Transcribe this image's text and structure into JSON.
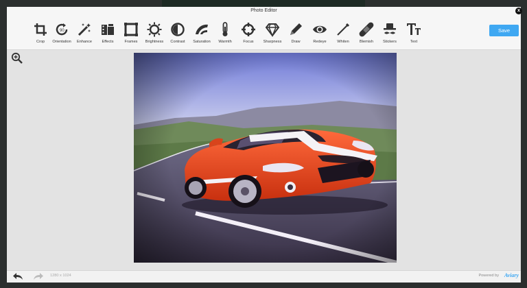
{
  "window": {
    "title": "Photo Editor",
    "close_label": "x"
  },
  "toolbar": {
    "tools": [
      {
        "label": "Crop",
        "icon": "crop-icon"
      },
      {
        "label": "Orientation",
        "icon": "orientation-icon"
      },
      {
        "label": "Enhance",
        "icon": "magic-wand-icon"
      },
      {
        "label": "Effects",
        "icon": "film-strip-icon"
      },
      {
        "label": "Frames",
        "icon": "frame-icon"
      },
      {
        "label": "Brightness",
        "icon": "sun-icon"
      },
      {
        "label": "Contrast",
        "icon": "contrast-icon"
      },
      {
        "label": "Saturation",
        "icon": "saturation-icon"
      },
      {
        "label": "Warmth",
        "icon": "thermometer-icon"
      },
      {
        "label": "Focus",
        "icon": "crosshair-icon"
      },
      {
        "label": "Sharpness",
        "icon": "diamond-icon"
      },
      {
        "label": "Draw",
        "icon": "pencil-icon"
      },
      {
        "label": "Redeye",
        "icon": "eye-icon"
      },
      {
        "label": "Whiten",
        "icon": "wand-icon"
      },
      {
        "label": "Blemish",
        "icon": "bandage-icon"
      },
      {
        "label": "Stickers",
        "icon": "hat-mustache-icon"
      },
      {
        "label": "Text",
        "icon": "text-icon"
      }
    ],
    "save_label": "Save"
  },
  "canvas": {
    "zoom_icon": "zoom-in-icon"
  },
  "footer": {
    "undo_icon": "undo-icon",
    "redo_icon": "redo-icon",
    "dimensions": "1280 x 1024",
    "powered_by": "Powered by",
    "brand": "Aviary"
  },
  "colors": {
    "accent": "#3fa8f2",
    "icon": "#333333",
    "car": "#e8451e"
  }
}
